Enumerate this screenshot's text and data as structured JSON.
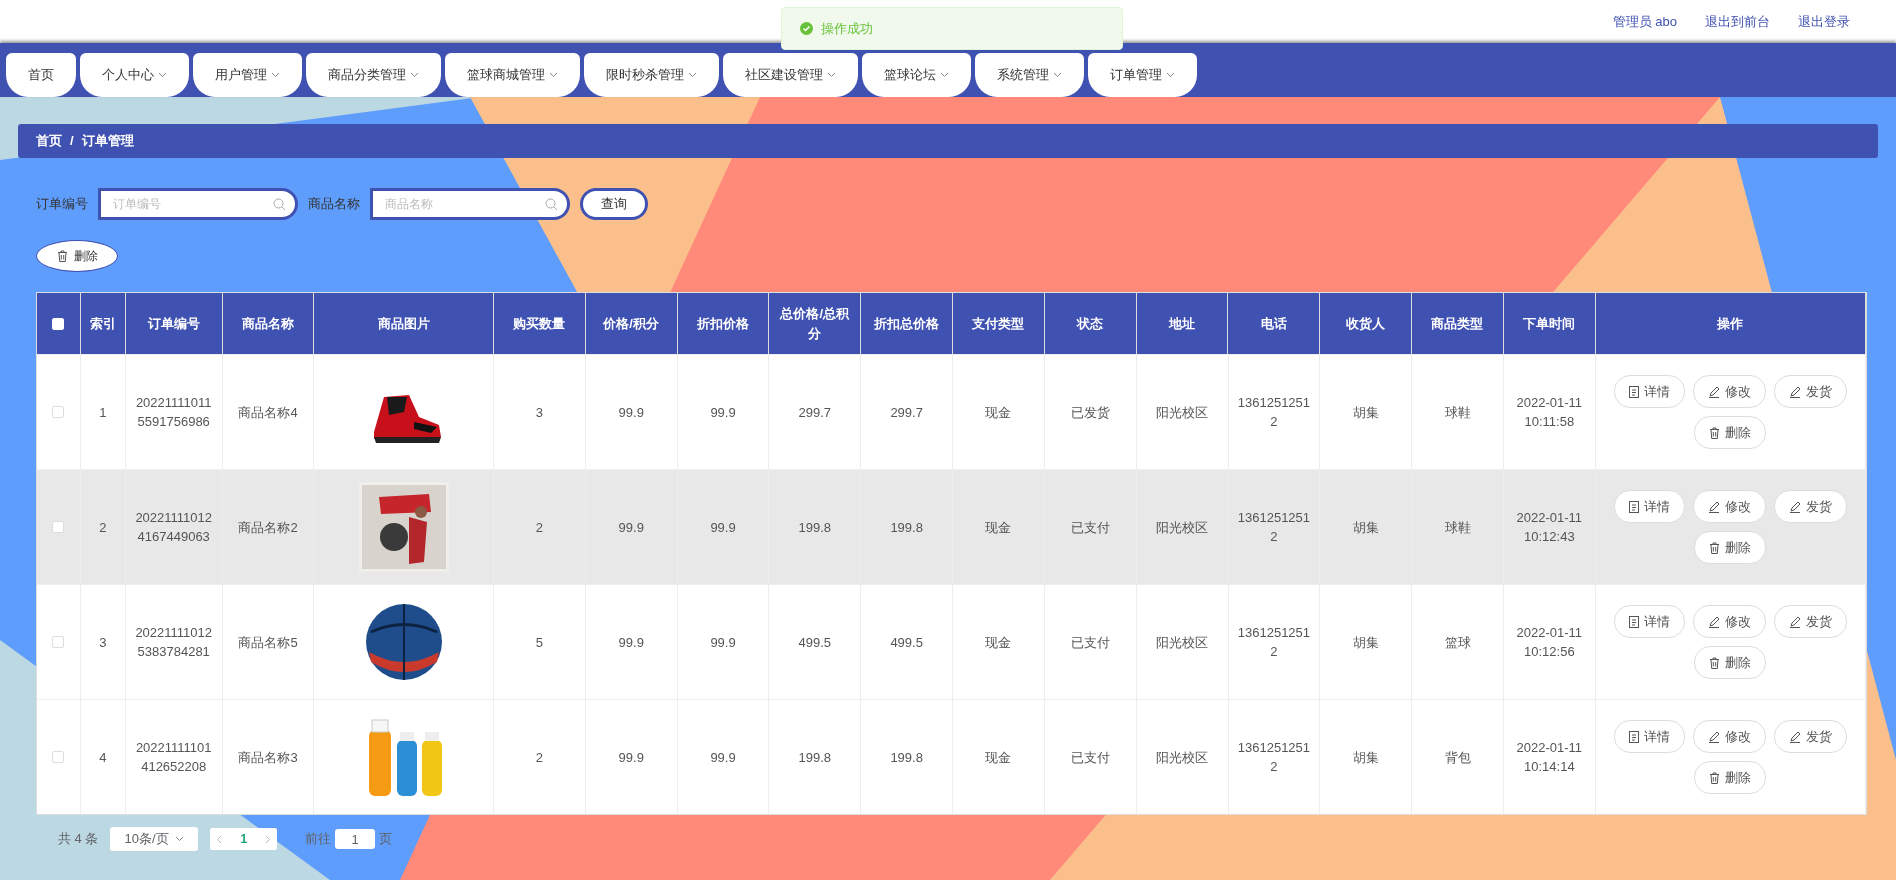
{
  "toast": {
    "message": "操作成功"
  },
  "header": {
    "links": [
      "管理员 abo",
      "退出到前台",
      "退出登录"
    ]
  },
  "nav": [
    {
      "label": "首页",
      "dropdown": false
    },
    {
      "label": "个人中心",
      "dropdown": true
    },
    {
      "label": "用户管理",
      "dropdown": true
    },
    {
      "label": "商品分类管理",
      "dropdown": true
    },
    {
      "label": "篮球商城管理",
      "dropdown": true
    },
    {
      "label": "限时秒杀管理",
      "dropdown": true
    },
    {
      "label": "社区建设管理",
      "dropdown": true
    },
    {
      "label": "篮球论坛",
      "dropdown": true
    },
    {
      "label": "系统管理",
      "dropdown": true
    },
    {
      "label": "订单管理",
      "dropdown": true
    }
  ],
  "breadcrumb": [
    "首页",
    "/",
    "订单管理"
  ],
  "search": [
    {
      "label": "订单编号",
      "placeholder": "订单编号"
    },
    {
      "label": "商品名称",
      "placeholder": "商品名称"
    }
  ],
  "query_button": "查询",
  "delete_button": "删除",
  "table": {
    "columns": [
      "索引",
      "订单编号",
      "商品名称",
      "商品图片",
      "购买数量",
      "价格/积分",
      "折扣价格",
      "总价格/总积分",
      "折扣总价格",
      "支付类型",
      "状态",
      "地址",
      "电话",
      "收货人",
      "商品类型",
      "下单时间",
      "操作"
    ],
    "header_checked": false,
    "rows": [
      {
        "checked": false,
        "hovered": false,
        "cells": [
          "1",
          "202211110115591756986",
          "商品名称4",
          {
            "kind": "picture"
          },
          "3",
          "99.9",
          "99.9",
          "299.7",
          "299.7",
          "现金",
          "已发货",
          "阳光校区",
          "13612512512",
          "胡集",
          "球鞋",
          "2022-01-11 10:11:58"
        ],
        "actions": [
          "详情",
          "修改",
          "发货",
          "删除"
        ]
      },
      {
        "checked": false,
        "hovered": true,
        "cells": [
          "2",
          "202211110124167449063",
          "商品名称2",
          {
            "kind": "picture"
          },
          "2",
          "99.9",
          "99.9",
          "199.8",
          "199.8",
          "现金",
          "已支付",
          "阳光校区",
          "13612512512",
          "胡集",
          "球鞋",
          "2022-01-11 10:12:43"
        ],
        "actions": [
          "详情",
          "修改",
          "发货",
          "删除"
        ]
      },
      {
        "checked": false,
        "hovered": false,
        "cells": [
          "3",
          "202211110125383784281",
          "商品名称5",
          {
            "kind": "picture"
          },
          "5",
          "99.9",
          "99.9",
          "499.5",
          "499.5",
          "现金",
          "已支付",
          "阳光校区",
          "13612512512",
          "胡集",
          "篮球",
          "2022-01-11 10:12:56"
        ],
        "actions": [
          "详情",
          "修改",
          "发货",
          "删除"
        ]
      },
      {
        "checked": false,
        "hovered": false,
        "cells": [
          "4",
          "20221111101412652208",
          "商品名称3",
          {
            "kind": "picture"
          },
          "2",
          "99.9",
          "99.9",
          "199.8",
          "199.8",
          "现金",
          "已支付",
          "阳光校区",
          "13612512512",
          "胡集",
          "背包",
          "2022-01-11 10:14:14"
        ],
        "actions": [
          "详情",
          "修改",
          "发货",
          "删除"
        ]
      }
    ]
  },
  "pagination": {
    "total": "共 4 条",
    "page_size": "10条/页",
    "pages": [
      {
        "label": "1",
        "selected": true
      }
    ],
    "goto_label": "前往",
    "goto_value": "1",
    "goto_suffix": "页"
  }
}
